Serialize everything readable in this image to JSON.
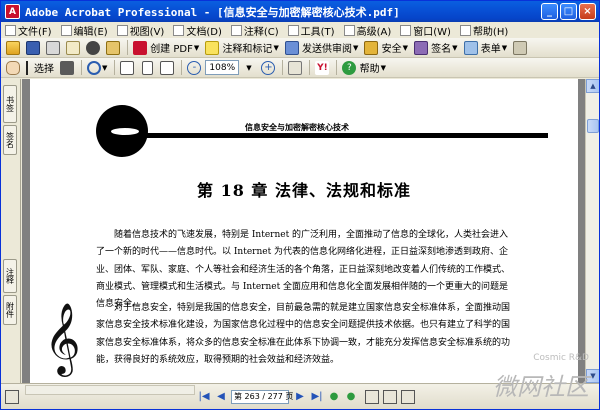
{
  "window": {
    "title": "Adobe Acrobat Professional - [信息安全与加密解密核心技术.pdf]",
    "app_icon_glyph": "A",
    "buttons": [
      "_",
      "□",
      "×"
    ]
  },
  "menu": {
    "items": [
      {
        "label": "文件(F)",
        "icon": "file-menu-icon"
      },
      {
        "label": "编辑(E)",
        "icon": "edit-menu-icon"
      },
      {
        "label": "视图(V)",
        "icon": "view-menu-icon"
      },
      {
        "label": "文档(D)",
        "icon": "document-menu-icon"
      },
      {
        "label": "注释(C)",
        "icon": "comment-menu-icon"
      },
      {
        "label": "工具(T)",
        "icon": "tools-menu-icon"
      },
      {
        "label": "高级(A)",
        "icon": "advanced-menu-icon"
      },
      {
        "label": "窗口(W)",
        "icon": "window-menu-icon"
      },
      {
        "label": "帮助(H)",
        "icon": "help-menu-icon"
      }
    ]
  },
  "toolbar1": {
    "create_pdf": "创建 PDF",
    "comment_markup": "注释和标记",
    "send_review": "发送供审阅",
    "security": "安全",
    "sign": "签名",
    "forms": "表单"
  },
  "toolbar2": {
    "select": "选择",
    "zoom": "108%",
    "help": "帮助"
  },
  "nav_tabs": [
    "书签",
    "签名",
    "注释",
    "附件"
  ],
  "page": {
    "header": "信息安全与加密解密核心技术",
    "chapter": "第 18 章   法律、法规和标准",
    "para1": "随着信息技术的飞速发展，特别是 Internet 的广泛利用，全面推动了信息的全球化，人类社会进入了一个新的时代——信息时代。以 Internet 为代表的信息化网络化进程，正日益深刻地渗透到政府、企业、团体、军队、家庭、个人等社会和经济生活的各个角落，正日益深刻地改变着人们传统的工作模式、商业模式、管理模式和生活模式。与 Internet 全面应用和信息化全面发展相伴随的一个更重大的问题是信息安全。",
    "para2": "对于信息安全，特别是我国的信息安全，目前最急需的就是建立国家信息安全标准体系，全面推动国家信息安全技术标准化建设，为国家信息化过程中的信息安全问题提供技术依据。也只有建立了科学的国家信息安全标准体系，将众多的信息安全标准在此体系下协调一致，才能充分发挥信息安全标准系统的功能，获得良好的系统效应，取得预期的社会效益和经济效益。",
    "clef": "𝄞"
  },
  "status": {
    "page_indicator": "第 263 / 277 页"
  },
  "watermark": {
    "top": "Cosmic R&D",
    "big": "微网社区"
  }
}
